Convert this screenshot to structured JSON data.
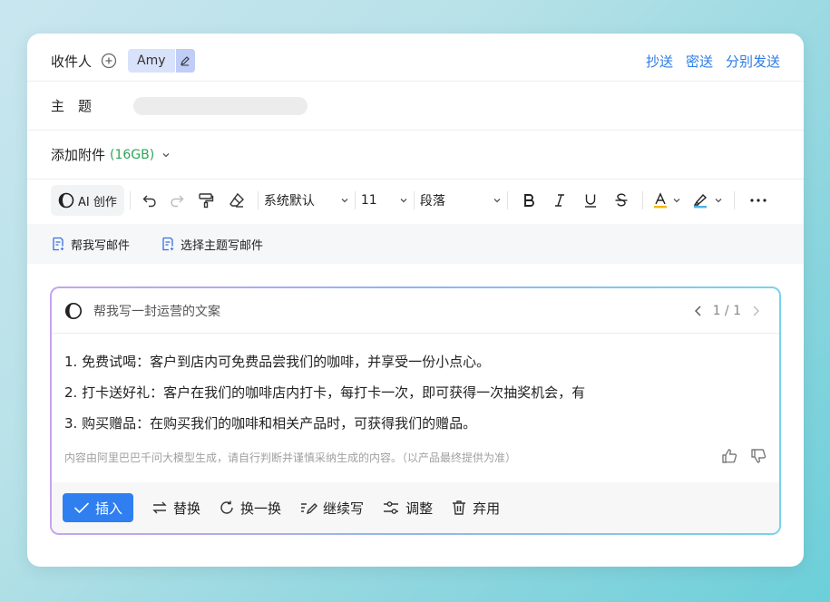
{
  "recipient": {
    "label": "收件人",
    "chip_name": "Amy"
  },
  "header_links": {
    "cc": "抄送",
    "bcc": "密送",
    "separate_send": "分别发送"
  },
  "subject": {
    "label": "主　题"
  },
  "attachment": {
    "label": "添加附件",
    "size": "(16GB)"
  },
  "toolbar": {
    "ai_label": "AI 创作",
    "font_family": "系统默认",
    "font_size": "11",
    "paragraph": "段落"
  },
  "quick_actions": {
    "help_write": "帮我写邮件",
    "choose_topic": "选择主题写邮件"
  },
  "ai_panel": {
    "prompt": "帮我写一封运营的文案",
    "page_indicator": "1 / 1",
    "lines": [
      "1. 免费试喝：客户到店内可免费品尝我们的咖啡，并享受一份小点心。",
      "2. 打卡送好礼：客户在我们的咖啡店内打卡，每打卡一次，即可获得一次抽奖机会，有",
      "3. 购买赠品：在购买我们的咖啡和相关产品时，可获得我们的赠品。"
    ],
    "disclaimer": "内容由阿里巴巴千问大模型生成，请自行判断并谨慎采纳生成的内容。（以产品最终提供为准）",
    "actions": {
      "insert": "插入",
      "replace": "替换",
      "refresh": "换一换",
      "continue": "继续写",
      "adjust": "调整",
      "discard": "弃用"
    }
  },
  "colors": {
    "link": "#2b7be4",
    "primary": "#2f7ff0",
    "size_green": "#2fa45a",
    "chip_bg": "#d9e2fb"
  }
}
